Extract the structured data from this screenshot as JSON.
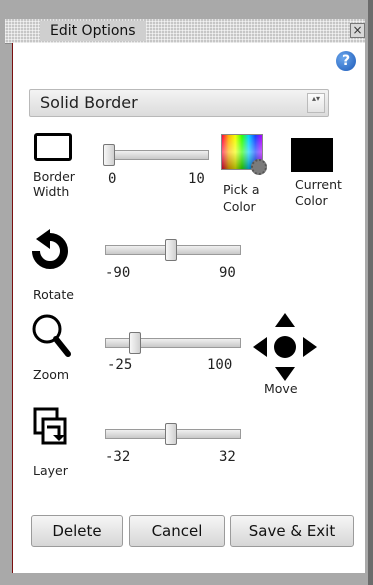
{
  "window": {
    "title": "Edit Options",
    "close_glyph": "×"
  },
  "help": {
    "glyph": "?"
  },
  "border_style": {
    "selected": "Solid Border",
    "arrows": "▴▾"
  },
  "border_width": {
    "label_line1": "Border",
    "label_line2": "Width",
    "min": "0",
    "max": "10",
    "value": 0
  },
  "pick_color": {
    "label_line1": "Pick a",
    "label_line2": "Color"
  },
  "current_color": {
    "label_line1": "Current",
    "label_line2": "Color",
    "value": "#000000"
  },
  "rotate": {
    "label": "Rotate",
    "min": "-90",
    "max": "90",
    "value": 0
  },
  "zoom": {
    "label": "Zoom",
    "min": "-25",
    "max": "100",
    "value": 0
  },
  "move": {
    "label": "Move"
  },
  "layer": {
    "label": "Layer",
    "min": "-32",
    "max": "32",
    "value": 0
  },
  "buttons": {
    "delete": "Delete",
    "cancel": "Cancel",
    "save_exit": "Save & Exit"
  },
  "icons": {
    "rotate": "rotate-icon",
    "zoom": "magnifier-icon",
    "move": "move-arrows-icon",
    "layer": "layer-icon",
    "help": "help-icon",
    "picker": "color-picker-icon"
  },
  "colors": {
    "panel_border": "#7a0f0f",
    "help_blue": "#1c5ab8"
  }
}
